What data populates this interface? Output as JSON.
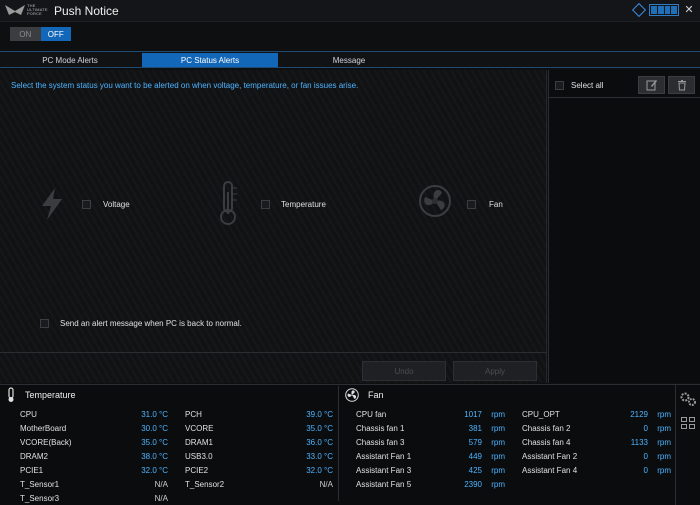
{
  "app": {
    "logo_text": [
      "THE",
      "ULTIMATE",
      "FORCE"
    ],
    "title": "Push Notice"
  },
  "toggle": {
    "on": "ON",
    "off": "OFF",
    "state": "OFF"
  },
  "tabs": [
    {
      "label": "PC Mode Alerts",
      "active": false
    },
    {
      "label": "PC Status Alerts",
      "active": true
    },
    {
      "label": "Message",
      "active": false
    }
  ],
  "main": {
    "hint": "Select the system status you want to be alerted on when voltage, temperature, or fan issues arise.",
    "options": [
      {
        "label": "Voltage",
        "icon": "lightning-icon"
      },
      {
        "label": "Temperature",
        "icon": "thermometer-icon"
      },
      {
        "label": "Fan",
        "icon": "fan-icon"
      }
    ],
    "return_msg": "Send an alert message when PC is back to normal.",
    "undo_label": "Undo",
    "apply_label": "Apply"
  },
  "side": {
    "select_all": "Select all",
    "edit_icon": "edit-icon",
    "delete_icon": "trash-icon"
  },
  "colors": {
    "accent": "#1367b8",
    "value": "#4db4ff",
    "bg": "#0e0f11"
  },
  "temperature": {
    "title": "Temperature",
    "left": [
      {
        "name": "CPU",
        "value": "31.0 °C"
      },
      {
        "name": "MotherBoard",
        "value": "30.0 °C"
      },
      {
        "name": "VCORE(Back)",
        "value": "35.0 °C"
      },
      {
        "name": "DRAM2",
        "value": "38.0 °C"
      },
      {
        "name": "PCIE1",
        "value": "32.0 °C"
      },
      {
        "name": "T_Sensor1",
        "value": "N/A"
      },
      {
        "name": "T_Sensor3",
        "value": "N/A"
      }
    ],
    "right": [
      {
        "name": "PCH",
        "value": "39.0 °C"
      },
      {
        "name": "VCORE",
        "value": "35.0 °C"
      },
      {
        "name": "DRAM1",
        "value": "36.0 °C"
      },
      {
        "name": "USB3.0",
        "value": "33.0 °C"
      },
      {
        "name": "PCIE2",
        "value": "32.0 °C"
      },
      {
        "name": "T_Sensor2",
        "value": "N/A"
      }
    ]
  },
  "fan": {
    "title": "Fan",
    "left": [
      {
        "name": "CPU fan",
        "value": "1017",
        "unit": "rpm"
      },
      {
        "name": "Chassis fan 1",
        "value": "381",
        "unit": "rpm"
      },
      {
        "name": "Chassis fan 3",
        "value": "579",
        "unit": "rpm"
      },
      {
        "name": "Assistant Fan 1",
        "value": "449",
        "unit": "rpm"
      },
      {
        "name": "Assistant Fan 3",
        "value": "425",
        "unit": "rpm"
      },
      {
        "name": "Assistant Fan 5",
        "value": "2390",
        "unit": "rpm"
      }
    ],
    "right": [
      {
        "name": "CPU_OPT",
        "value": "2129",
        "unit": "rpm"
      },
      {
        "name": "Chassis fan 2",
        "value": "0",
        "unit": "rpm"
      },
      {
        "name": "Chassis fan 4",
        "value": "1133",
        "unit": "rpm"
      },
      {
        "name": "Assistant Fan 2",
        "value": "0",
        "unit": "rpm"
      },
      {
        "name": "Assistant Fan 4",
        "value": "0",
        "unit": "rpm"
      }
    ]
  }
}
